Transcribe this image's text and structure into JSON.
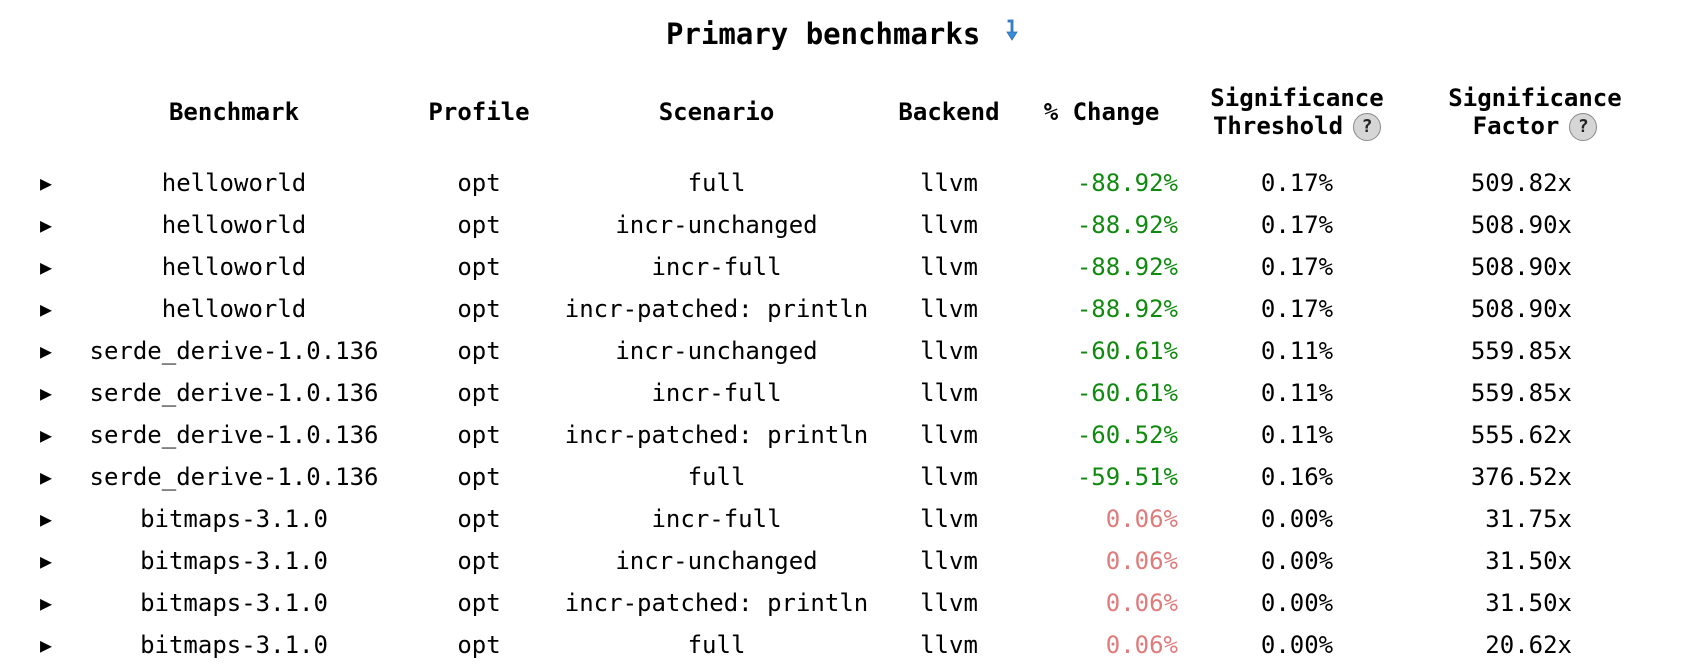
{
  "title": "Primary benchmarks",
  "title_icon": "sort-descending-arrow-icon",
  "colors": {
    "negative_change": "#0f8a0f",
    "positive_change": "#e07b7b",
    "icon_blue": "#3b8bd6"
  },
  "table": {
    "headers": {
      "benchmark": "Benchmark",
      "profile": "Profile",
      "scenario": "Scenario",
      "backend": "Backend",
      "change": "% Change",
      "threshold_line1": "Significance",
      "threshold_line2": "Threshold",
      "factor_line1": "Significance",
      "factor_line2": "Factor",
      "help_glyph": "?"
    },
    "expand_glyph": "▶",
    "rows": [
      {
        "benchmark": "helloworld",
        "profile": "opt",
        "scenario": "full",
        "backend": "llvm",
        "change": "-88.92%",
        "direction": "neg",
        "threshold": "0.17%",
        "factor": "509.82x"
      },
      {
        "benchmark": "helloworld",
        "profile": "opt",
        "scenario": "incr-unchanged",
        "backend": "llvm",
        "change": "-88.92%",
        "direction": "neg",
        "threshold": "0.17%",
        "factor": "508.90x"
      },
      {
        "benchmark": "helloworld",
        "profile": "opt",
        "scenario": "incr-full",
        "backend": "llvm",
        "change": "-88.92%",
        "direction": "neg",
        "threshold": "0.17%",
        "factor": "508.90x"
      },
      {
        "benchmark": "helloworld",
        "profile": "opt",
        "scenario": "incr-patched: println",
        "backend": "llvm",
        "change": "-88.92%",
        "direction": "neg",
        "threshold": "0.17%",
        "factor": "508.90x"
      },
      {
        "benchmark": "serde_derive-1.0.136",
        "profile": "opt",
        "scenario": "incr-unchanged",
        "backend": "llvm",
        "change": "-60.61%",
        "direction": "neg",
        "threshold": "0.11%",
        "factor": "559.85x"
      },
      {
        "benchmark": "serde_derive-1.0.136",
        "profile": "opt",
        "scenario": "incr-full",
        "backend": "llvm",
        "change": "-60.61%",
        "direction": "neg",
        "threshold": "0.11%",
        "factor": "559.85x"
      },
      {
        "benchmark": "serde_derive-1.0.136",
        "profile": "opt",
        "scenario": "incr-patched: println",
        "backend": "llvm",
        "change": "-60.52%",
        "direction": "neg",
        "threshold": "0.11%",
        "factor": "555.62x"
      },
      {
        "benchmark": "serde_derive-1.0.136",
        "profile": "opt",
        "scenario": "full",
        "backend": "llvm",
        "change": "-59.51%",
        "direction": "neg",
        "threshold": "0.16%",
        "factor": "376.52x"
      },
      {
        "benchmark": "bitmaps-3.1.0",
        "profile": "opt",
        "scenario": "incr-full",
        "backend": "llvm",
        "change": "0.06%",
        "direction": "pos",
        "threshold": "0.00%",
        "factor": "31.75x"
      },
      {
        "benchmark": "bitmaps-3.1.0",
        "profile": "opt",
        "scenario": "incr-unchanged",
        "backend": "llvm",
        "change": "0.06%",
        "direction": "pos",
        "threshold": "0.00%",
        "factor": "31.50x"
      },
      {
        "benchmark": "bitmaps-3.1.0",
        "profile": "opt",
        "scenario": "incr-patched: println",
        "backend": "llvm",
        "change": "0.06%",
        "direction": "pos",
        "threshold": "0.00%",
        "factor": "31.50x"
      },
      {
        "benchmark": "bitmaps-3.1.0",
        "profile": "opt",
        "scenario": "full",
        "backend": "llvm",
        "change": "0.06%",
        "direction": "pos",
        "threshold": "0.00%",
        "factor": "20.62x"
      }
    ]
  }
}
